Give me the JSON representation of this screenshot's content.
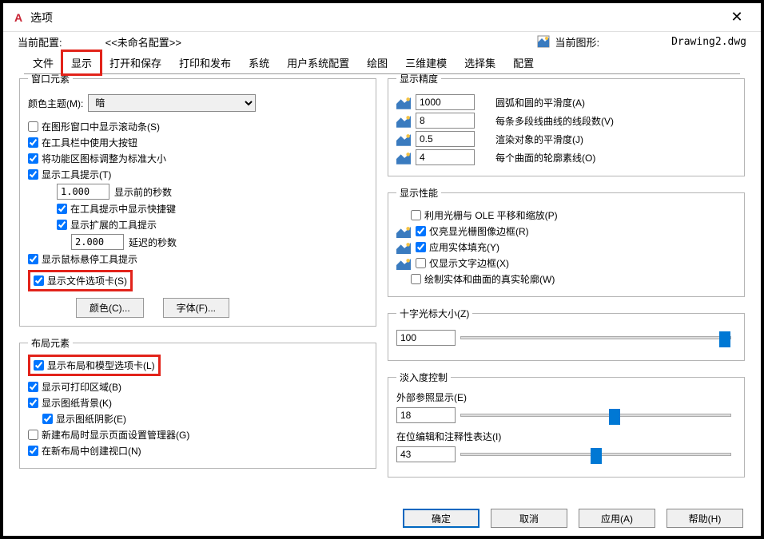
{
  "window": {
    "title": "选项"
  },
  "header": {
    "profile_label": "当前配置:",
    "profile_value": "<<未命名配置>>",
    "drawing_label": "当前图形:",
    "drawing_name": "Drawing2.dwg"
  },
  "tabs": [
    "文件",
    "显示",
    "打开和保存",
    "打印和发布",
    "系统",
    "用户系统配置",
    "绘图",
    "三维建模",
    "选择集",
    "配置"
  ],
  "window_elements": {
    "legend": "窗口元素",
    "theme_label": "颜色主题(M):",
    "theme_value": "暗",
    "scrollbars": "在图形窗口中显示滚动条(S)",
    "big_buttons": "在工具栏中使用大按钮",
    "resize_ribbon": "将功能区图标调整为标准大小",
    "show_tooltips": "显示工具提示(T)",
    "seconds_before": "1.000",
    "seconds_before_label": "显示前的秒数",
    "shortcut_in_tip": "在工具提示中显示快捷键",
    "extended_tip": "显示扩展的工具提示",
    "delay_seconds": "2.000",
    "delay_seconds_label": "延迟的秒数",
    "hover_tip": "显示鼠标悬停工具提示",
    "file_tabs": "显示文件选项卡(S)",
    "color_btn": "颜色(C)...",
    "font_btn": "字体(F)..."
  },
  "layout_elements": {
    "legend": "布局元素",
    "show_layout_model": "显示布局和模型选项卡(L)",
    "printable_area": "显示可打印区域(B)",
    "paper_bg": "显示图纸背景(K)",
    "paper_shadow": "显示图纸阴影(E)",
    "new_layout_setup": "新建布局时显示页面设置管理器(G)",
    "create_viewport": "在新布局中创建视口(N)"
  },
  "display_precision": {
    "legend": "显示精度",
    "arc_smooth_val": "1000",
    "arc_smooth": "圆弧和圆的平滑度(A)",
    "polyline_segs_val": "8",
    "polyline_segs": "每条多段线曲线的线段数(V)",
    "render_smooth_val": "0.5",
    "render_smooth": "渲染对象的平滑度(J)",
    "surf_isolines_val": "4",
    "surf_isolines": "每个曲面的轮廓素线(O)"
  },
  "display_perf": {
    "legend": "显示性能",
    "raster_ole": "利用光栅与 OLE 平移和缩放(P)",
    "raster_frame": "仅亮显光栅图像边框(R)",
    "solid_fill": "应用实体填充(Y)",
    "text_frame": "仅显示文字边框(X)",
    "true_silhouette": "绘制实体和曲面的真实轮廓(W)"
  },
  "crosshair": {
    "legend": "十字光标大小(Z)",
    "value": "100"
  },
  "fade": {
    "legend": "淡入度控制",
    "xref_label": "外部参照显示(E)",
    "xref_value": "18",
    "inplace_label": "在位编辑和注释性表达(I)",
    "inplace_value": "43"
  },
  "footer": {
    "ok": "确定",
    "cancel": "取消",
    "apply": "应用(A)",
    "help": "帮助(H)"
  }
}
